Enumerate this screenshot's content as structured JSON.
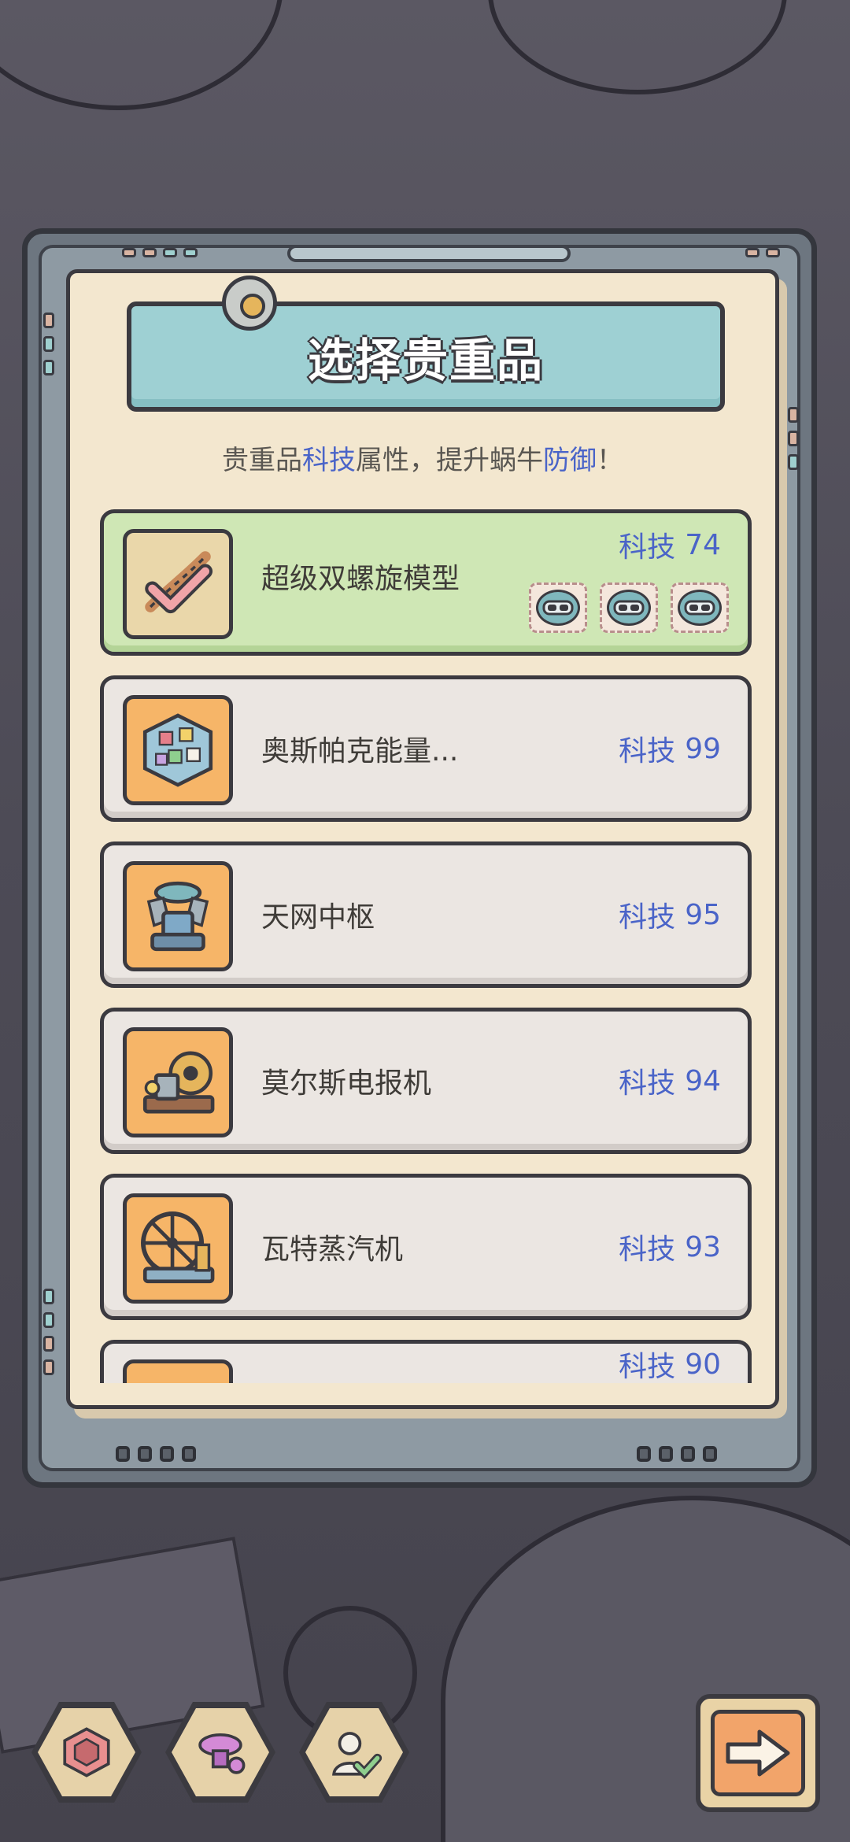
{
  "dialog": {
    "title": "选择贵重品",
    "subtitle_parts": [
      "贵重品",
      "科技",
      "属性，提升蜗牛",
      "防御",
      "！"
    ]
  },
  "items": [
    {
      "name": "超级双螺旋模型",
      "stat_label": "科技",
      "stat_value": "74",
      "selected": true,
      "icon": "double-helix-icon",
      "slots": 3
    },
    {
      "name": "奥斯帕克能量...",
      "stat_label": "科技",
      "stat_value": "99",
      "selected": false,
      "icon": "energy-cube-icon"
    },
    {
      "name": "天网中枢",
      "stat_label": "科技",
      "stat_value": "95",
      "selected": false,
      "icon": "skynet-hub-icon"
    },
    {
      "name": "莫尔斯电报机",
      "stat_label": "科技",
      "stat_value": "94",
      "selected": false,
      "icon": "telegraph-icon"
    },
    {
      "name": "瓦特蒸汽机",
      "stat_label": "科技",
      "stat_value": "93",
      "selected": false,
      "icon": "steam-engine-icon"
    },
    {
      "name": "",
      "stat_label": "科技",
      "stat_value": "90",
      "selected": false,
      "icon": "item-icon"
    }
  ],
  "bottom_bar": {
    "buttons": [
      "rune-icon",
      "gear-tool-icon",
      "avatar-check-icon"
    ],
    "next_icon": "arrow-right-icon"
  },
  "colors": {
    "accent_blue": "#4a64c8",
    "selected_card": "#cfe7b5",
    "thumb_orange": "#f6b568"
  }
}
